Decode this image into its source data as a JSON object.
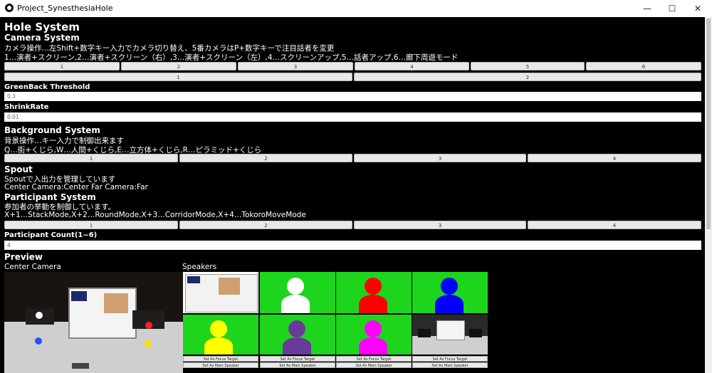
{
  "window": {
    "title": "Project_SynesthesiaHole",
    "minimize": "—",
    "maximize": "☐",
    "close": "✕"
  },
  "hole": {
    "title": "Hole System"
  },
  "camera": {
    "title": "Camera System",
    "desc1": "カメラ操作…左Shift+数字キー入力でカメラ切り替え、5番カメラはP+数字キーで注目話者を変更",
    "desc2": "1…演者+スクリーン,2…演者+スクリーン（右）,3…演者+スクリーン（左）,4…スクリーンアップ,5…話者アップ,6…廊下周遊モード",
    "buttons": [
      "1",
      "2",
      "3",
      "4",
      "5",
      "6"
    ],
    "buttons2": [
      "1",
      "2"
    ]
  },
  "greenback": {
    "label": "GreenBack Threshold",
    "value": "0.3"
  },
  "shrink": {
    "label": "ShrinkRate",
    "value": "0.01"
  },
  "background": {
    "title": "Background System",
    "desc1": "背景操作…キー入力で制御出来ます",
    "desc2": "Q…街+くじら,W…人間+くじら,E…立方体+くじら,R…ピラミッド+くじら",
    "buttons": [
      "1",
      "2",
      "3",
      "4"
    ]
  },
  "spout": {
    "title": "Spout",
    "desc1": "Spoutで入出力を管理しています",
    "desc2": "Center Camera:Center    Far Camera:Far"
  },
  "participant": {
    "title": "Participant System",
    "desc1": "参加者の挙動を制御しています。",
    "desc2": "X+1…StackMode,X+2…RoundMode,X+3…CorridorMode,X+4…TokoroMoveMode",
    "buttons": [
      "1",
      "2",
      "3",
      "4"
    ],
    "count_label": "Participant Count(1~6)",
    "count_value": "4"
  },
  "preview": {
    "title": "Preview",
    "center_label": "Center Camera",
    "speakers_label": "Speakers",
    "focus_label": "Set As Focus Target",
    "main_label": "Set As Main Speaker",
    "avatar_colors": [
      "#ffffff",
      "#ff0000",
      "#0000ff",
      "#ffff00",
      "#6a3a9a",
      "#ff00ff"
    ]
  }
}
